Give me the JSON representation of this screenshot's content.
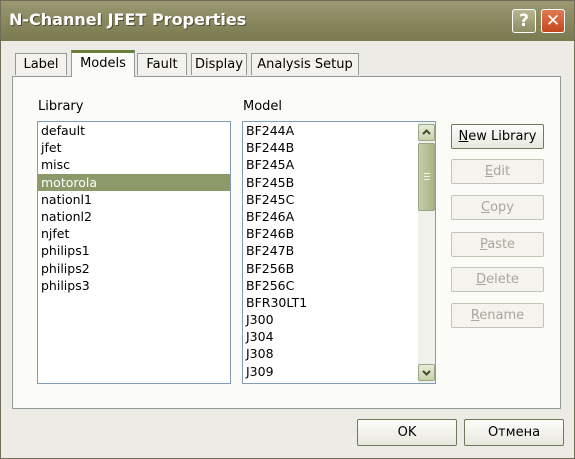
{
  "window": {
    "title": "N-Channel JFET Properties",
    "help_glyph": "?",
    "close_glyph": "✕"
  },
  "tabs": [
    {
      "label": "Label",
      "active": false
    },
    {
      "label": "Models",
      "active": true
    },
    {
      "label": "Fault",
      "active": false
    },
    {
      "label": "Display",
      "active": false
    },
    {
      "label": "Analysis Setup",
      "active": false
    }
  ],
  "library": {
    "header": "Library",
    "selected": "motorola",
    "items": [
      "default",
      "jfet",
      "misc",
      "motorola",
      "nationl1",
      "nationl2",
      "njfet",
      "philips1",
      "philips2",
      "philips3"
    ]
  },
  "model": {
    "header": "Model",
    "items": [
      "BF244A",
      "BF244B",
      "BF245A",
      "BF245B",
      "BF245C",
      "BF246A",
      "BF246B",
      "BF247B",
      "BF256B",
      "BF256C",
      "BFR30LT1",
      "J300",
      "J304",
      "J308",
      "J309"
    ]
  },
  "buttons": {
    "new_library": {
      "first": "N",
      "rest": "ew Library"
    },
    "edit": {
      "first": "E",
      "rest": "dit"
    },
    "copy": {
      "first": "C",
      "rest": "opy"
    },
    "paste": {
      "first": "P",
      "rest": "aste"
    },
    "delete": {
      "first": "D",
      "rest": "elete"
    },
    "rename": {
      "first": "R",
      "rest": "ename"
    }
  },
  "dialog": {
    "ok": "OK",
    "cancel": "Отмена"
  }
}
